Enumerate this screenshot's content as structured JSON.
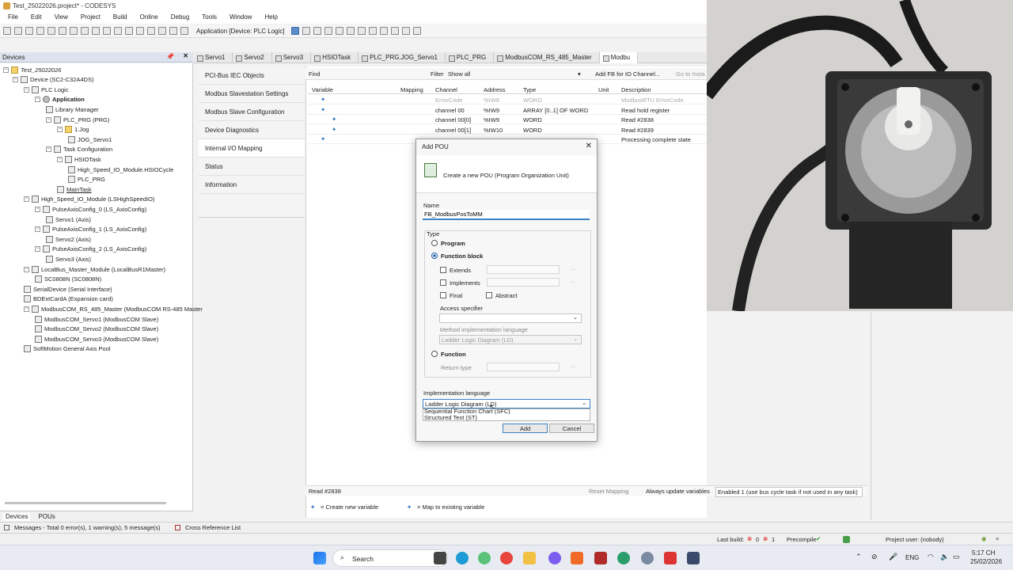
{
  "window": {
    "title": "Test_25022026.project* - CODESYS"
  },
  "menu": [
    "File",
    "Edit",
    "View",
    "Project",
    "Build",
    "Online",
    "Debug",
    "Tools",
    "Window",
    "Help"
  ],
  "toolbar": {
    "device_selector": "Application [Device: PLC Logic]"
  },
  "devices_panel": {
    "title": "Devices",
    "tree": [
      {
        "label": "Test_25022026",
        "italic": true
      },
      {
        "label": "Device (SC2-C32A4DS)"
      },
      {
        "label": "PLC Logic"
      },
      {
        "label": "Application",
        "bold": true
      },
      {
        "label": "Library Manager"
      },
      {
        "label": "PLC_PRG (PRG)"
      },
      {
        "label": "1.Jog"
      },
      {
        "label": "JOG_Servo1"
      },
      {
        "label": "Task Configuration"
      },
      {
        "label": "HSIOTask"
      },
      {
        "label": "High_Speed_IO_Module.HSIOCycle"
      },
      {
        "label": "PLC_PRG"
      },
      {
        "label": "MainTask",
        "underline": true
      },
      {
        "label": "High_Speed_IO_Module (LSHighSpeedIO)"
      },
      {
        "label": "PulseAxisConfig_0 (LS_AxisConfig)"
      },
      {
        "label": "Servo1 (Axis)"
      },
      {
        "label": "PulseAxisConfig_1 (LS_AxisConfig)"
      },
      {
        "label": "Servo2 (Axis)"
      },
      {
        "label": "PulseAxisConfig_2 (LS_AxisConfig)"
      },
      {
        "label": "Servo3 (Axis)"
      },
      {
        "label": "LocalBus_Master_Module (LocalBusR1Master)"
      },
      {
        "label": "SC0808N (SC0808N)"
      },
      {
        "label": "SerialDevice (Serial Interface)"
      },
      {
        "label": "BDExtCardA (Expansion card)"
      },
      {
        "label": "ModbusCOM_RS_485_Master (ModbusCOM RS-485 Master"
      },
      {
        "label": "ModbusCOM_Servo1 (ModbusCOM Slave)"
      },
      {
        "label": "ModbusCOM_Servo2 (ModbusCOM Slave)"
      },
      {
        "label": "ModbusCOM_Servo3 (ModbusCOM Slave)"
      },
      {
        "label": "SoftMotion General Axis Pool"
      }
    ],
    "bottom_tabs": [
      "Devices",
      "POUs"
    ]
  },
  "doc_tabs": [
    "Servo1",
    "Servo2",
    "Servo3",
    "HSIOTask",
    "PLC_PRG.JOG_Servo1",
    "PLC_PRG",
    "ModbusCOM_RS_485_Master",
    "Modbu"
  ],
  "side_nav": [
    "PCI-Bus IEC Objects",
    "Modbus Slavestation Settings",
    "Modbus Slave Configuration",
    "Device Diagnostics",
    "Internal I/O Mapping",
    "Status",
    "Information"
  ],
  "find_bar": {
    "find_label": "Find",
    "filter_label": "Filter",
    "filter_value": "Show all",
    "add_fb": "Add FB for IO Channel...",
    "goto": "Go to Insta"
  },
  "grid": {
    "headers": [
      "Variable",
      "Mapping",
      "Channel",
      "Address",
      "Type",
      "Unit",
      "Description"
    ],
    "rows": [
      {
        "channel": "ErrorCode",
        "address": "%IW8",
        "type": "WORD",
        "unit": "",
        "description": "ModbusRTU ErrorCode",
        "dim": true
      },
      {
        "channel": "channel 00",
        "address": "%IW9",
        "type": "ARRAY [0..1] OF WORD",
        "unit": "",
        "description": "Read hold register"
      },
      {
        "channel": "channel 00[0]",
        "address": "%IW9",
        "type": "WORD",
        "unit": "",
        "description": "Read #2838"
      },
      {
        "channel": "channel 00[1]",
        "address": "%IW10",
        "type": "WORD",
        "unit": "",
        "description": "Read #2839"
      },
      {
        "channel": "",
        "address": "",
        "type": "",
        "unit": "",
        "description": "Processing complete state"
      }
    ]
  },
  "bottom_status": {
    "selected": "Read #2838",
    "reset_mapping": "Reset Mapping",
    "always_update": "Always update variables",
    "enabled_option": "Enabled 1 (use bus cycle task if not used in any task)"
  },
  "legend": {
    "create": "= Create new variable",
    "map": "= Map to existing variable"
  },
  "dialog": {
    "title": "Add POU",
    "header_text": "Create a new POU (Program Organization Unit)",
    "name_label": "Name",
    "name_value": "FB_ModbusPosToMM",
    "type_label": "Type",
    "program": "Program",
    "function_block": "Function block",
    "extends": "Extends",
    "implements": "Implements",
    "final": "Final",
    "abstract": "Abstract",
    "access_specifier": "Access specifier",
    "method_impl_lang": "Method implementation language",
    "method_impl_value": "Ladder Logic Diagram (LD)",
    "function": "Function",
    "return_type": "Return type",
    "impl_lang_label": "Implementation language",
    "impl_lang_value": "Ladder Logic Diagram (LD)",
    "dropdown_options": [
      "Sequential Function Chart (SFC)",
      "Structured Text (ST)"
    ],
    "add": "Add",
    "cancel": "Cancel",
    "ellipsis": "..."
  },
  "messages_bar": {
    "messages": "Messages - Total 0 error(s), 1 warning(s), 5 message(s)",
    "xref": "Cross Reference List"
  },
  "status_bar": {
    "last_build": "Last build:",
    "errors": "0",
    "warnings": "1",
    "precompile": "Precompile",
    "project_user": "Project user: (nobody)"
  },
  "taskbar": {
    "search": "Search",
    "lang": "ENG",
    "time": "5:17 CH",
    "date": "25/02/2026"
  }
}
